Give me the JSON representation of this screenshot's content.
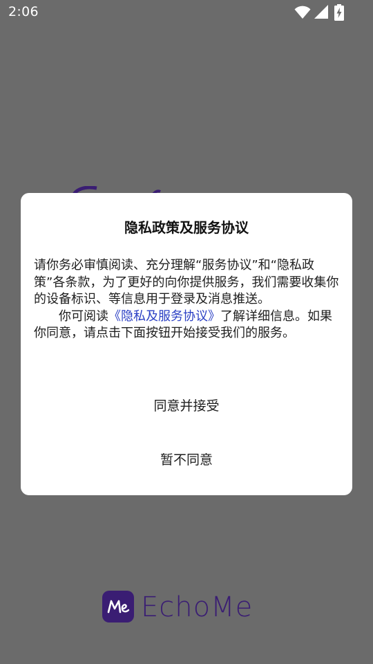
{
  "status_bar": {
    "time": "2:06",
    "icons": [
      "wifi-icon",
      "cellular-signal-icon",
      "battery-charging-icon"
    ]
  },
  "dialog": {
    "title": "隐私政策及服务协议",
    "paragraph1": "请你务必审慎阅读、充分理解“服务协议”和“隐私政策”各条款，为了更好的向你提供服务，我们需要收集你的设备标识、等信息用于登录及消息推送。",
    "paragraph2_prefix": "你可阅读",
    "paragraph2_link": "《隐私及服务协议》",
    "paragraph2_suffix": "了解详细信息。如果你同意，请点击下面按钮开始接受我们的服务。",
    "agree_label": "同意并接受",
    "decline_label": "暂不同意"
  },
  "branding": {
    "logo_mark": "Me",
    "logo_text": "EchoMe",
    "brand_color": "#3a1d73"
  },
  "colors": {
    "scrim": "#6b6b6b",
    "link": "#2a3fc4",
    "text": "#1e1e1e"
  }
}
